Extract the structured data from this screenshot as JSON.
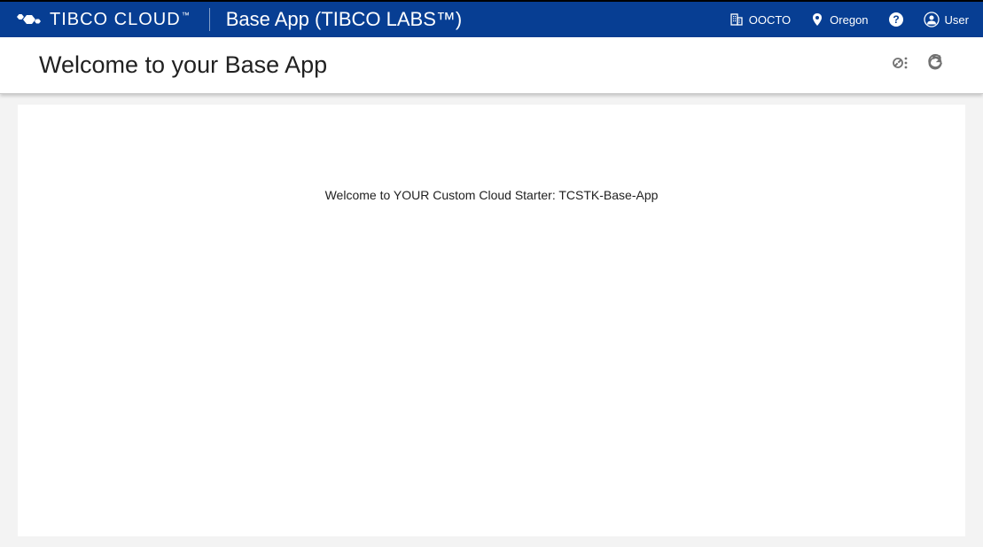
{
  "header": {
    "brand": "TIBCO CLOUD",
    "brand_tm": "™",
    "app_title": "Base App (TIBCO LABS™)",
    "org": "OOCTO",
    "region": "Oregon",
    "user": "User"
  },
  "subheader": {
    "page_title": "Welcome to your Base App"
  },
  "main": {
    "welcome_message": "Welcome to YOUR Custom Cloud Starter: TCSTK-Base-App"
  }
}
